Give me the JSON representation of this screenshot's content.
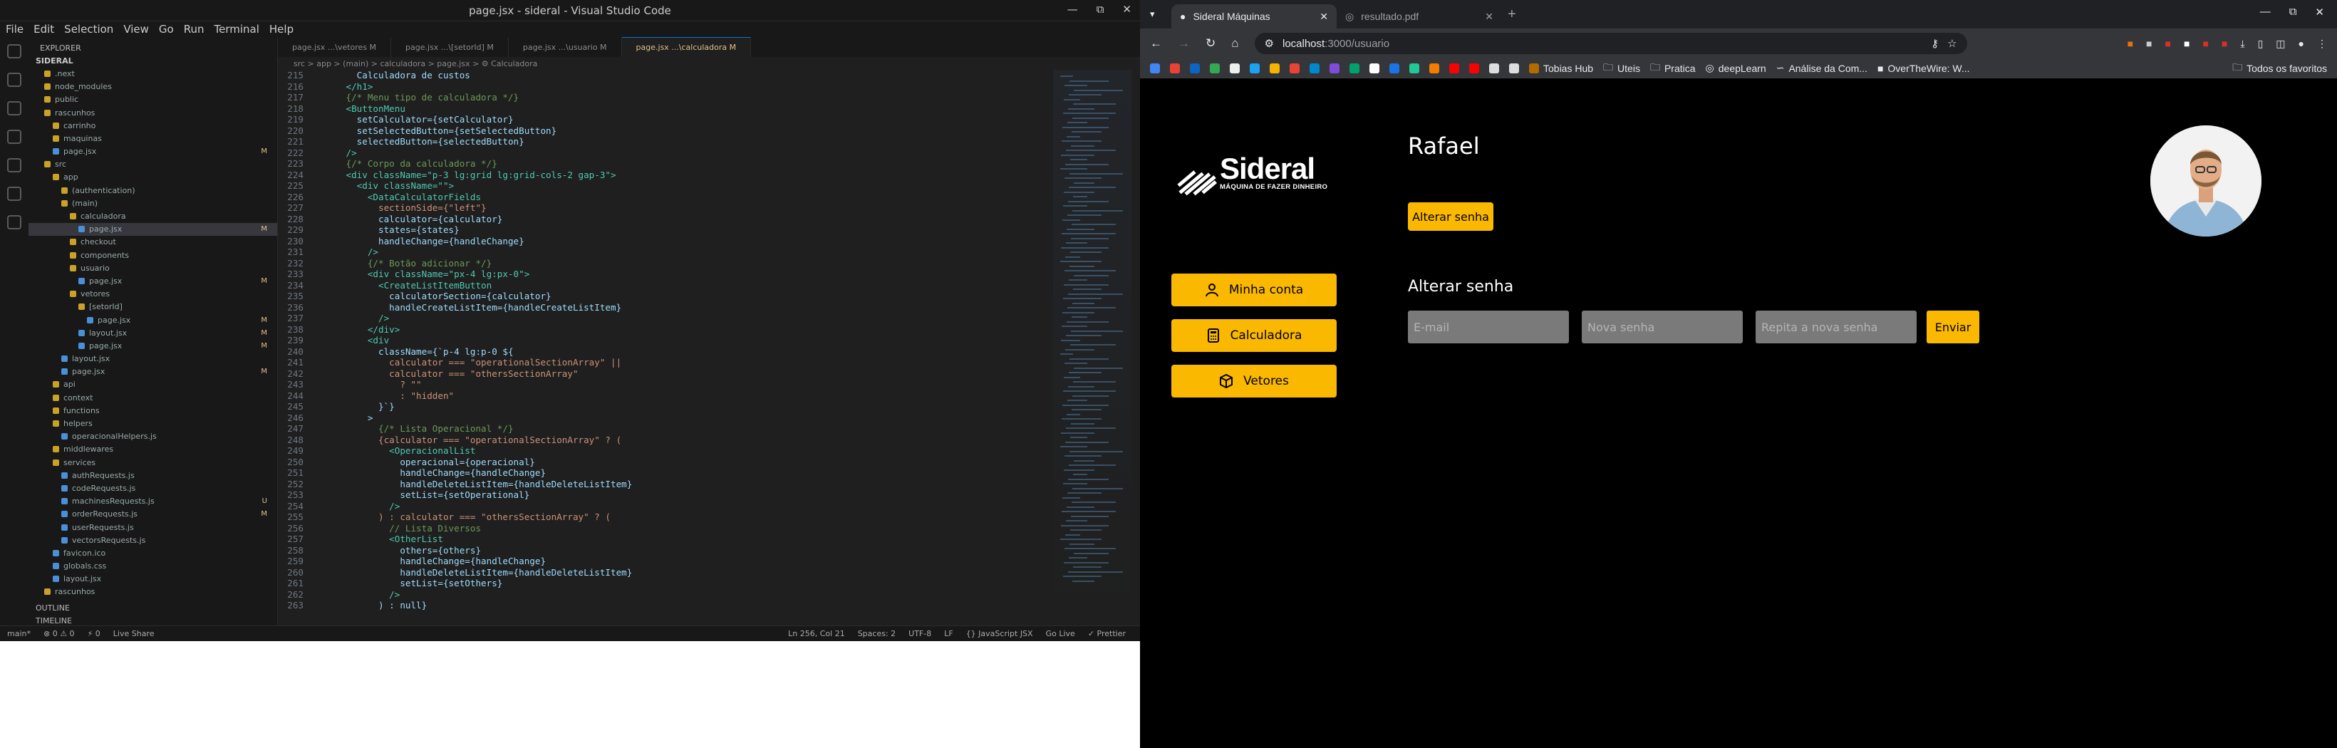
{
  "vscode": {
    "title": "page.jsx - sideral - Visual Studio Code",
    "menu": [
      "File",
      "Edit",
      "Selection",
      "View",
      "Go",
      "Run",
      "Terminal",
      "Help"
    ],
    "tabs": [
      "page.jsx ...\\vetores M",
      "page.jsx ...\\[setorId] M",
      "page.jsx ...\\usuario M",
      "page.jsx ...\\calculadora M"
    ],
    "breadcrumb": "src > app > (main) > calculadora > page.jsx > ⚙ Calculadora",
    "explorer_title": "EXPLORER",
    "explorer_root": "SIDERAL",
    "explorer": [
      {
        "name": ".next",
        "badge": ""
      },
      {
        "name": "node_modules",
        "badge": ""
      },
      {
        "name": "public",
        "badge": ""
      },
      {
        "name": "rascunhos",
        "badge": ""
      },
      {
        "name": "carrinho",
        "badge": ""
      },
      {
        "name": "maquinas",
        "badge": ""
      },
      {
        "name": "page.jsx",
        "badge": "M"
      },
      {
        "name": "src",
        "badge": ""
      },
      {
        "name": "app",
        "badge": ""
      },
      {
        "name": "(authentication)",
        "badge": ""
      },
      {
        "name": "(main)",
        "badge": ""
      },
      {
        "name": "calculadora",
        "badge": ""
      },
      {
        "name": "page.jsx",
        "badge": "M"
      },
      {
        "name": "checkout",
        "badge": ""
      },
      {
        "name": "components",
        "badge": ""
      },
      {
        "name": "usuario",
        "badge": ""
      },
      {
        "name": "page.jsx",
        "badge": "M"
      },
      {
        "name": "vetores",
        "badge": ""
      },
      {
        "name": "[setorId]",
        "badge": ""
      },
      {
        "name": "page.jsx",
        "badge": "M"
      },
      {
        "name": "layout.jsx",
        "badge": "M"
      },
      {
        "name": "page.jsx",
        "badge": "M"
      },
      {
        "name": "layout.jsx",
        "badge": ""
      },
      {
        "name": "page.jsx",
        "badge": "M"
      },
      {
        "name": "api",
        "badge": ""
      },
      {
        "name": "context",
        "badge": ""
      },
      {
        "name": "functions",
        "badge": ""
      },
      {
        "name": "helpers",
        "badge": ""
      },
      {
        "name": "operacionalHelpers.js",
        "badge": ""
      },
      {
        "name": "middlewares",
        "badge": ""
      },
      {
        "name": "services",
        "badge": ""
      },
      {
        "name": "authRequests.js",
        "badge": ""
      },
      {
        "name": "codeRequests.js",
        "badge": ""
      },
      {
        "name": "machinesRequests.js",
        "badge": "U"
      },
      {
        "name": "orderRequests.js",
        "badge": "M"
      },
      {
        "name": "userRequests.js",
        "badge": ""
      },
      {
        "name": "vectorsRequests.js",
        "badge": ""
      },
      {
        "name": "favicon.ico",
        "badge": ""
      },
      {
        "name": "globals.css",
        "badge": ""
      },
      {
        "name": "layout.jsx",
        "badge": ""
      },
      {
        "name": "rascunhos",
        "badge": ""
      }
    ],
    "outline": "OUTLINE",
    "timeline": "TIMELINE",
    "code": [
      {
        "n": "215",
        "t": "        Calculadora de custos"
      },
      {
        "n": "216",
        "t": "      </h1>"
      },
      {
        "n": "217",
        "t": "      {/* Menu tipo de calculadora */}"
      },
      {
        "n": "218",
        "t": "      <ButtonMenu"
      },
      {
        "n": "219",
        "t": "        setCalculator={setCalculator}"
      },
      {
        "n": "220",
        "t": "        setSelectedButton={setSelectedButton}"
      },
      {
        "n": "221",
        "t": "        selectedButton={selectedButton}"
      },
      {
        "n": "222",
        "t": "      />"
      },
      {
        "n": "223",
        "t": "      {/* Corpo da calculadora */}"
      },
      {
        "n": "224",
        "t": "      <div className=\"p-3 lg:grid lg:grid-cols-2 gap-3\">"
      },
      {
        "n": "225",
        "t": "        <div className=\"\">"
      },
      {
        "n": "226",
        "t": "          <DataCalculatorFields"
      },
      {
        "n": "227",
        "t": "            sectionSide={\"left\"}"
      },
      {
        "n": "228",
        "t": "            calculator={calculator}"
      },
      {
        "n": "229",
        "t": "            states={states}"
      },
      {
        "n": "230",
        "t": "            handleChange={handleChange}"
      },
      {
        "n": "231",
        "t": "          />"
      },
      {
        "n": "232",
        "t": "          {/* Botão adicionar */}"
      },
      {
        "n": "233",
        "t": "          <div className=\"px-4 lg:px-0\">"
      },
      {
        "n": "234",
        "t": "            <CreateListItemButton"
      },
      {
        "n": "235",
        "t": "              calculatorSection={calculator}"
      },
      {
        "n": "236",
        "t": "              handleCreateListItem={handleCreateListItem}"
      },
      {
        "n": "237",
        "t": "            />"
      },
      {
        "n": "238",
        "t": "          </div>"
      },
      {
        "n": "239",
        "t": "          <div"
      },
      {
        "n": "240",
        "t": "            className={`p-4 lg:p-0 ${"
      },
      {
        "n": "241",
        "t": "              calculator === \"operationalSectionArray\" ||"
      },
      {
        "n": "242",
        "t": "              calculator === \"othersSectionArray\""
      },
      {
        "n": "243",
        "t": "                ? \"\""
      },
      {
        "n": "244",
        "t": "                : \"hidden\""
      },
      {
        "n": "245",
        "t": "            }`}"
      },
      {
        "n": "246",
        "t": "          >"
      },
      {
        "n": "247",
        "t": "            {/* Lista Operacional */}"
      },
      {
        "n": "248",
        "t": "            {calculator === \"operationalSectionArray\" ? ("
      },
      {
        "n": "249",
        "t": "              <OperacionalList"
      },
      {
        "n": "250",
        "t": "                operacional={operacional}"
      },
      {
        "n": "251",
        "t": "                handleChange={handleChange}"
      },
      {
        "n": "252",
        "t": "                handleDeleteListItem={handleDeleteListItem}"
      },
      {
        "n": "253",
        "t": "                setList={setOperational}"
      },
      {
        "n": "254",
        "t": "              />"
      },
      {
        "n": "255",
        "t": "            ) : calculator === \"othersSectionArray\" ? ("
      },
      {
        "n": "256",
        "t": "              // Lista Diversos"
      },
      {
        "n": "257",
        "t": "              <OtherList"
      },
      {
        "n": "258",
        "t": "                others={others}"
      },
      {
        "n": "259",
        "t": "                handleChange={handleChange}"
      },
      {
        "n": "260",
        "t": "                handleDeleteListItem={handleDeleteListItem}"
      },
      {
        "n": "261",
        "t": "                setList={setOthers}"
      },
      {
        "n": "262",
        "t": "              />"
      },
      {
        "n": "263",
        "t": "            ) : null}"
      }
    ],
    "status_left": [
      "main*",
      "⊗ 0 ⚠ 0",
      "⚡ 0",
      "Live Share"
    ],
    "status_right": [
      "Ln 256, Col 21",
      "Spaces: 2",
      "UTF-8",
      "LF",
      "{} JavaScript JSX",
      "Go Live",
      "✓ Prettier"
    ]
  },
  "chrome": {
    "tabs": [
      {
        "title": "Sideral Máquinas",
        "active": true
      },
      {
        "title": "resultado.pdf",
        "active": false
      }
    ],
    "url_host": "localhost",
    "url_path": ":3000/usuario",
    "bookmarks": [
      "Tobias Hub",
      "Uteis",
      "Pratica",
      "deepLearn",
      "Análise da Com...",
      "OverTheWire: W...",
      "Todos os favoritos"
    ]
  },
  "app": {
    "logo_title": "Sideral",
    "logo_subtitle": "MÁQUINA DE FAZER DINHEIRO",
    "user_name": "Rafael",
    "change_password_button": "Alterar senha",
    "nav": [
      "Minha conta",
      "Calculadora",
      "Vetores"
    ],
    "section_title": "Alterar senha",
    "email_placeholder": "E-mail",
    "new_password_placeholder": "Nova senha",
    "repeat_password_placeholder": "Repita a nova senha",
    "submit": "Enviar",
    "accent": "#fbb800"
  }
}
